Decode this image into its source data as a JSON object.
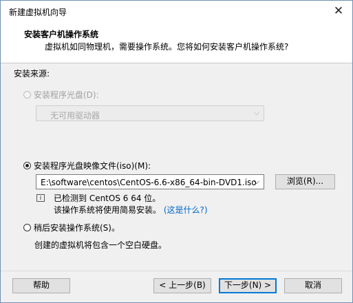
{
  "window": {
    "title": "新建虚拟机向导",
    "close_glyph": "✕"
  },
  "header": {
    "title": "安装客户机操作系统",
    "subtitle": "虚拟机如同物理机，需要操作系统。您将如何安装客户机操作系统?"
  },
  "source_label": "安装来源:",
  "option_disc": {
    "label": "安装程序光盘(D):",
    "drive_value": "无可用驱动器",
    "enabled": false
  },
  "option_iso": {
    "label": "安装程序光盘映像文件(iso)(M):",
    "path": "E:\\software\\centos\\CentOS-6.6-x86_64-bin-DVD1.iso",
    "browse": "浏览(R)...",
    "detected": "已检测到 CentOS 6 64 位。",
    "easy_install": "该操作系统将使用简易安装。",
    "whats_this": "(这是什么?)",
    "selected": true
  },
  "option_later": {
    "label": "稍后安装操作系统(S)。",
    "description": "创建的虚拟机将包含一个空白硬盘。"
  },
  "buttons": {
    "help": "帮助",
    "back": "< 上一步(B)",
    "next": "下一步(N) >",
    "cancel": "取消"
  }
}
